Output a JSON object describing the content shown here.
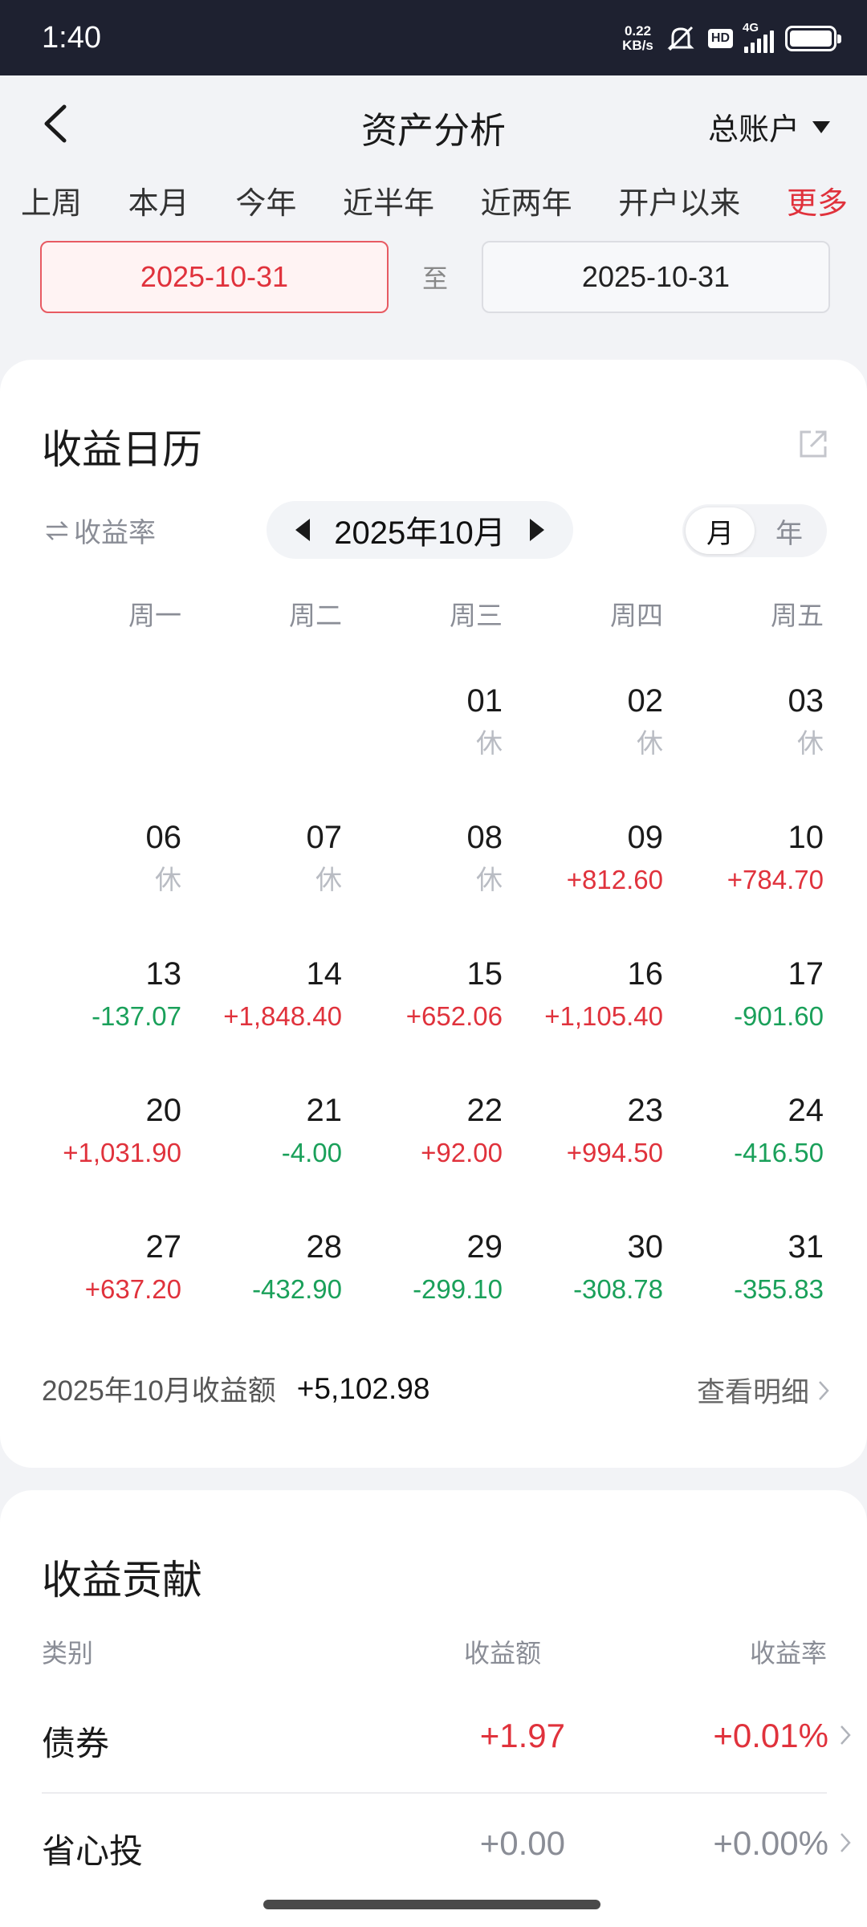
{
  "status": {
    "time": "1:40",
    "net_speed_value": "0.22",
    "net_speed_unit": "KB/s",
    "hd": "HD",
    "network": "4G",
    "battery_level": 1.0
  },
  "header": {
    "title": "资产分析",
    "account": "总账户"
  },
  "periods": [
    {
      "label": "上周",
      "active": false
    },
    {
      "label": "本月",
      "active": false
    },
    {
      "label": "今年",
      "active": false
    },
    {
      "label": "近半年",
      "active": false
    },
    {
      "label": "近两年",
      "active": false
    },
    {
      "label": "开户以来",
      "active": false
    },
    {
      "label": "更多",
      "active": true
    }
  ],
  "date_range": {
    "start": "2025-10-31",
    "separator": "至",
    "end": "2025-10-31"
  },
  "calendar": {
    "title": "收益日历",
    "metric_toggle": "收益率",
    "month": "2025年10月",
    "mode_month": "月",
    "mode_year": "年",
    "weekdays": [
      "周一",
      "周二",
      "周三",
      "周四",
      "周五"
    ],
    "rows": [
      [
        {
          "day": "",
          "value": "",
          "kind": "empty"
        },
        {
          "day": "",
          "value": "",
          "kind": "empty"
        },
        {
          "day": "01",
          "value": "休",
          "kind": "rest"
        },
        {
          "day": "02",
          "value": "休",
          "kind": "rest"
        },
        {
          "day": "03",
          "value": "休",
          "kind": "rest"
        }
      ],
      [
        {
          "day": "06",
          "value": "休",
          "kind": "rest"
        },
        {
          "day": "07",
          "value": "休",
          "kind": "rest"
        },
        {
          "day": "08",
          "value": "休",
          "kind": "rest"
        },
        {
          "day": "09",
          "value": "+812.60",
          "kind": "pos"
        },
        {
          "day": "10",
          "value": "+784.70",
          "kind": "pos"
        }
      ],
      [
        {
          "day": "13",
          "value": "-137.07",
          "kind": "neg"
        },
        {
          "day": "14",
          "value": "+1,848.40",
          "kind": "pos"
        },
        {
          "day": "15",
          "value": "+652.06",
          "kind": "pos"
        },
        {
          "day": "16",
          "value": "+1,105.40",
          "kind": "pos"
        },
        {
          "day": "17",
          "value": "-901.60",
          "kind": "neg"
        }
      ],
      [
        {
          "day": "20",
          "value": "+1,031.90",
          "kind": "pos"
        },
        {
          "day": "21",
          "value": "-4.00",
          "kind": "neg"
        },
        {
          "day": "22",
          "value": "+92.00",
          "kind": "pos"
        },
        {
          "day": "23",
          "value": "+994.50",
          "kind": "pos"
        },
        {
          "day": "24",
          "value": "-416.50",
          "kind": "neg"
        }
      ],
      [
        {
          "day": "27",
          "value": "+637.20",
          "kind": "pos"
        },
        {
          "day": "28",
          "value": "-432.90",
          "kind": "neg"
        },
        {
          "day": "29",
          "value": "-299.10",
          "kind": "neg"
        },
        {
          "day": "30",
          "value": "-308.78",
          "kind": "neg"
        },
        {
          "day": "31",
          "value": "-355.83",
          "kind": "neg"
        }
      ]
    ],
    "summary_label": "2025年10月收益额",
    "summary_value": "+5,102.98",
    "detail_link": "查看明细"
  },
  "contribution": {
    "title": "收益贡献",
    "headers": {
      "category": "类别",
      "amount": "收益额",
      "rate": "收益率"
    },
    "rows": [
      {
        "name": "债券",
        "amount": "+1.97",
        "rate": "+0.01%",
        "tone": "red"
      },
      {
        "name": "省心投",
        "amount": "+0.00",
        "rate": "+0.00%",
        "tone": "gray"
      }
    ]
  },
  "colors": {
    "positive": "#e0323c",
    "negative": "#1aa05a",
    "accent": "#e0323c"
  }
}
